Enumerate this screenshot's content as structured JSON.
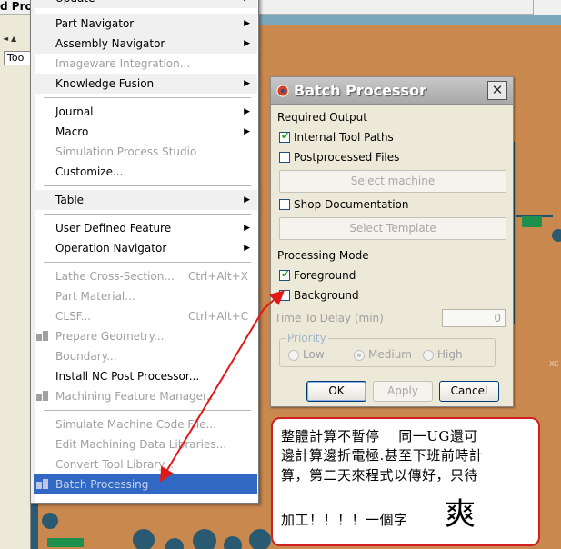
{
  "background": {
    "title": "d Pro",
    "tool_tab": "Too"
  },
  "menu": {
    "items": [
      {
        "label": "Update",
        "disabled": false,
        "submenu": true
      },
      {
        "label": "Part Navigator",
        "disabled": false,
        "submenu": true
      },
      {
        "label": "Assembly Navigator",
        "disabled": false,
        "submenu": true
      },
      {
        "label": "Imageware Integration...",
        "disabled": true,
        "submenu": false
      },
      {
        "label": "Knowledge Fusion",
        "disabled": false,
        "submenu": true
      },
      {
        "label": "Journal",
        "disabled": false,
        "submenu": true
      },
      {
        "label": "Macro",
        "disabled": false,
        "submenu": true
      },
      {
        "label": "Simulation Process Studio",
        "disabled": true,
        "submenu": false
      },
      {
        "label": "Customize...",
        "disabled": false,
        "submenu": false
      },
      {
        "label": "Table",
        "disabled": false,
        "submenu": true
      },
      {
        "label": "User Defined Feature",
        "disabled": false,
        "submenu": true
      },
      {
        "label": "Operation Navigator",
        "disabled": false,
        "submenu": true
      },
      {
        "label": "Lathe Cross-Section...",
        "disabled": true,
        "submenu": false,
        "shortcut": "Ctrl+Alt+X"
      },
      {
        "label": "Part Material...",
        "disabled": true,
        "submenu": false
      },
      {
        "label": "CLSF...",
        "disabled": true,
        "submenu": false,
        "shortcut": "Ctrl+Alt+C"
      },
      {
        "label": "Prepare Geometry...",
        "disabled": true,
        "submenu": false
      },
      {
        "label": "Boundary...",
        "disabled": true,
        "submenu": false
      },
      {
        "label": "Install NC Post Processor...",
        "disabled": false,
        "submenu": false
      },
      {
        "label": "Machining Feature Manager...",
        "disabled": true,
        "submenu": false
      },
      {
        "label": "Simulate Machine Code File...",
        "disabled": true,
        "submenu": false
      },
      {
        "label": "Edit Machining Data Libraries...",
        "disabled": true,
        "submenu": false
      },
      {
        "label": "Convert Tool Library...",
        "disabled": true,
        "submenu": false
      },
      {
        "label": "Batch Processing",
        "disabled": false,
        "submenu": false,
        "selected": true
      }
    ]
  },
  "dialog": {
    "title": "Batch Processor",
    "close_glyph": "✕",
    "required_output": "Required Output",
    "internal_tool_paths": "Internal Tool Paths",
    "postprocessed_files": "Postprocessed Files",
    "select_machine": "Select machine",
    "shop_documentation": "Shop Documentation",
    "select_template": "Select Template",
    "processing_mode": "Processing Mode",
    "foreground": "Foreground",
    "background": "Background",
    "time_to_delay": "Time To Delay (min)",
    "time_to_delay_value": "0",
    "priority": "Priority",
    "priority_low": "Low",
    "priority_medium": "Medium",
    "priority_high": "High",
    "ok": "OK",
    "apply": "Apply",
    "cancel": "Cancel",
    "checked": {
      "internal_tool_paths": true,
      "postprocessed_files": false,
      "shop_documentation": false,
      "foreground": true,
      "background": false
    }
  },
  "note": {
    "line1": "整體計算不暫停　 同一UG還可",
    "line2": "邊計算邊折電極.甚至下班前時計",
    "line3": "算，第二天來程式以傳好，只待",
    "line4": "加工！！！！一個字",
    "big_char": "爽"
  },
  "colors": {
    "selection": "#3168c4",
    "annotation_red": "#d02020",
    "check_green": "#21a121"
  }
}
